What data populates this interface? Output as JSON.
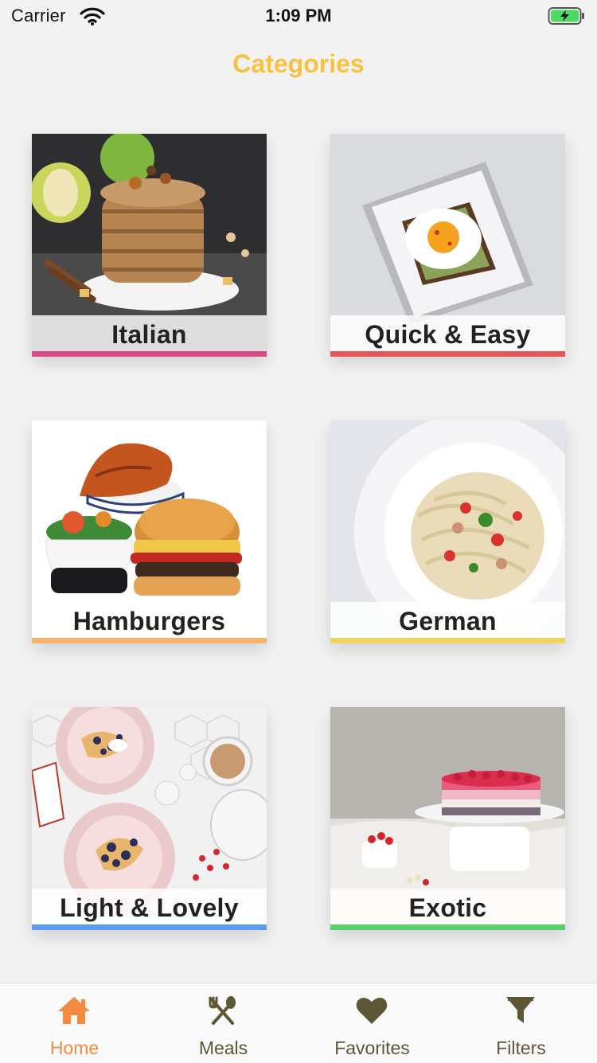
{
  "status_bar": {
    "carrier": "Carrier",
    "time": "1:09 PM"
  },
  "header": {
    "title": "Categories"
  },
  "colors": {
    "title": "#f8c140",
    "active_tab": "#f38a3f",
    "inactive_tab": "#5e5636"
  },
  "categories": [
    {
      "label": "Italian",
      "accent": "#dd4a8a"
    },
    {
      "label": "Quick & Easy",
      "accent": "#e95757"
    },
    {
      "label": "Hamburgers",
      "accent": "#f7b36b"
    },
    {
      "label": "German",
      "accent": "#f1d25b"
    },
    {
      "label": "Light & Lovely",
      "accent": "#5b9cf2"
    },
    {
      "label": "Exotic",
      "accent": "#56d268"
    }
  ],
  "tabs": [
    {
      "label": "Home",
      "icon": "home-icon",
      "active": true
    },
    {
      "label": "Meals",
      "icon": "utensils-icon",
      "active": false
    },
    {
      "label": "Favorites",
      "icon": "heart-icon",
      "active": false
    },
    {
      "label": "Filters",
      "icon": "filter-icon",
      "active": false
    }
  ]
}
